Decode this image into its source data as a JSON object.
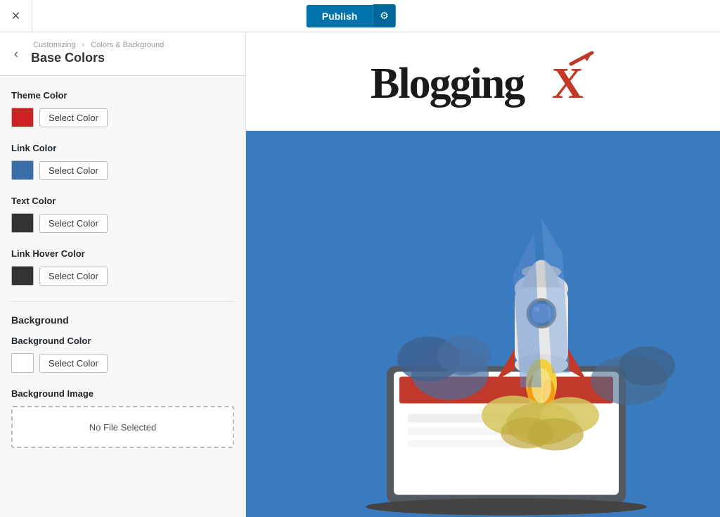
{
  "topbar": {
    "close_label": "✕",
    "publish_label": "Publish",
    "gear_label": "⚙"
  },
  "sidebar": {
    "back_label": "‹",
    "breadcrumb": {
      "part1": "Customizing",
      "separator": "›",
      "part2": "Colors & Background"
    },
    "section_title": "Base Colors",
    "colors": [
      {
        "id": "theme-color",
        "label": "Theme Color",
        "swatch": "#cc2222",
        "button_label": "Select Color"
      },
      {
        "id": "link-color",
        "label": "Link Color",
        "swatch": "#3a6ea8",
        "button_label": "Select Color"
      },
      {
        "id": "text-color",
        "label": "Text Color",
        "swatch": "#333333",
        "button_label": "Select Color"
      },
      {
        "id": "link-hover-color",
        "label": "Link Hover Color",
        "swatch": "#333333",
        "button_label": "Select Color"
      }
    ],
    "background_section_label": "Background",
    "background_color": {
      "label": "Background Color",
      "swatch": "#ffffff",
      "button_label": "Select Color"
    },
    "background_image": {
      "label": "Background Image",
      "no_file_label": "No File Selected"
    }
  },
  "preview": {
    "logo_text": "Blogging",
    "logo_x": "X"
  }
}
